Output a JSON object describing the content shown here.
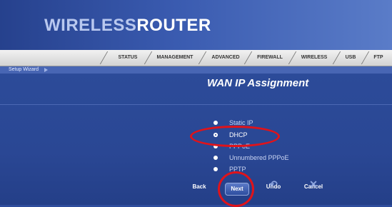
{
  "brand": {
    "part1": "WIRELESS",
    "part2": "ROUTER"
  },
  "nav": {
    "tabs": [
      "STATUS",
      "MANAGEMENT",
      "ADVANCED",
      "FIREWALL",
      "WIRELESS",
      "USB",
      "FTP"
    ]
  },
  "breadcrumb": {
    "label": "Setup Wizard"
  },
  "page": {
    "title": "WAN IP Assignment"
  },
  "options": [
    {
      "label": "Static IP",
      "selected": false
    },
    {
      "label": "DHCP",
      "selected": true
    },
    {
      "label": "PPPoE",
      "selected": false
    },
    {
      "label": "Unnumbered PPPoE",
      "selected": false
    },
    {
      "label": "PPTP",
      "selected": false
    }
  ],
  "buttons": {
    "back": "Back",
    "next": "Next",
    "undo": "Undo",
    "cancel": "Cancel"
  },
  "annotations": {
    "highlight_color": "#e0131a"
  },
  "icons": {
    "undo": "undo-arrow-icon",
    "cancel": "cancel-icon"
  }
}
